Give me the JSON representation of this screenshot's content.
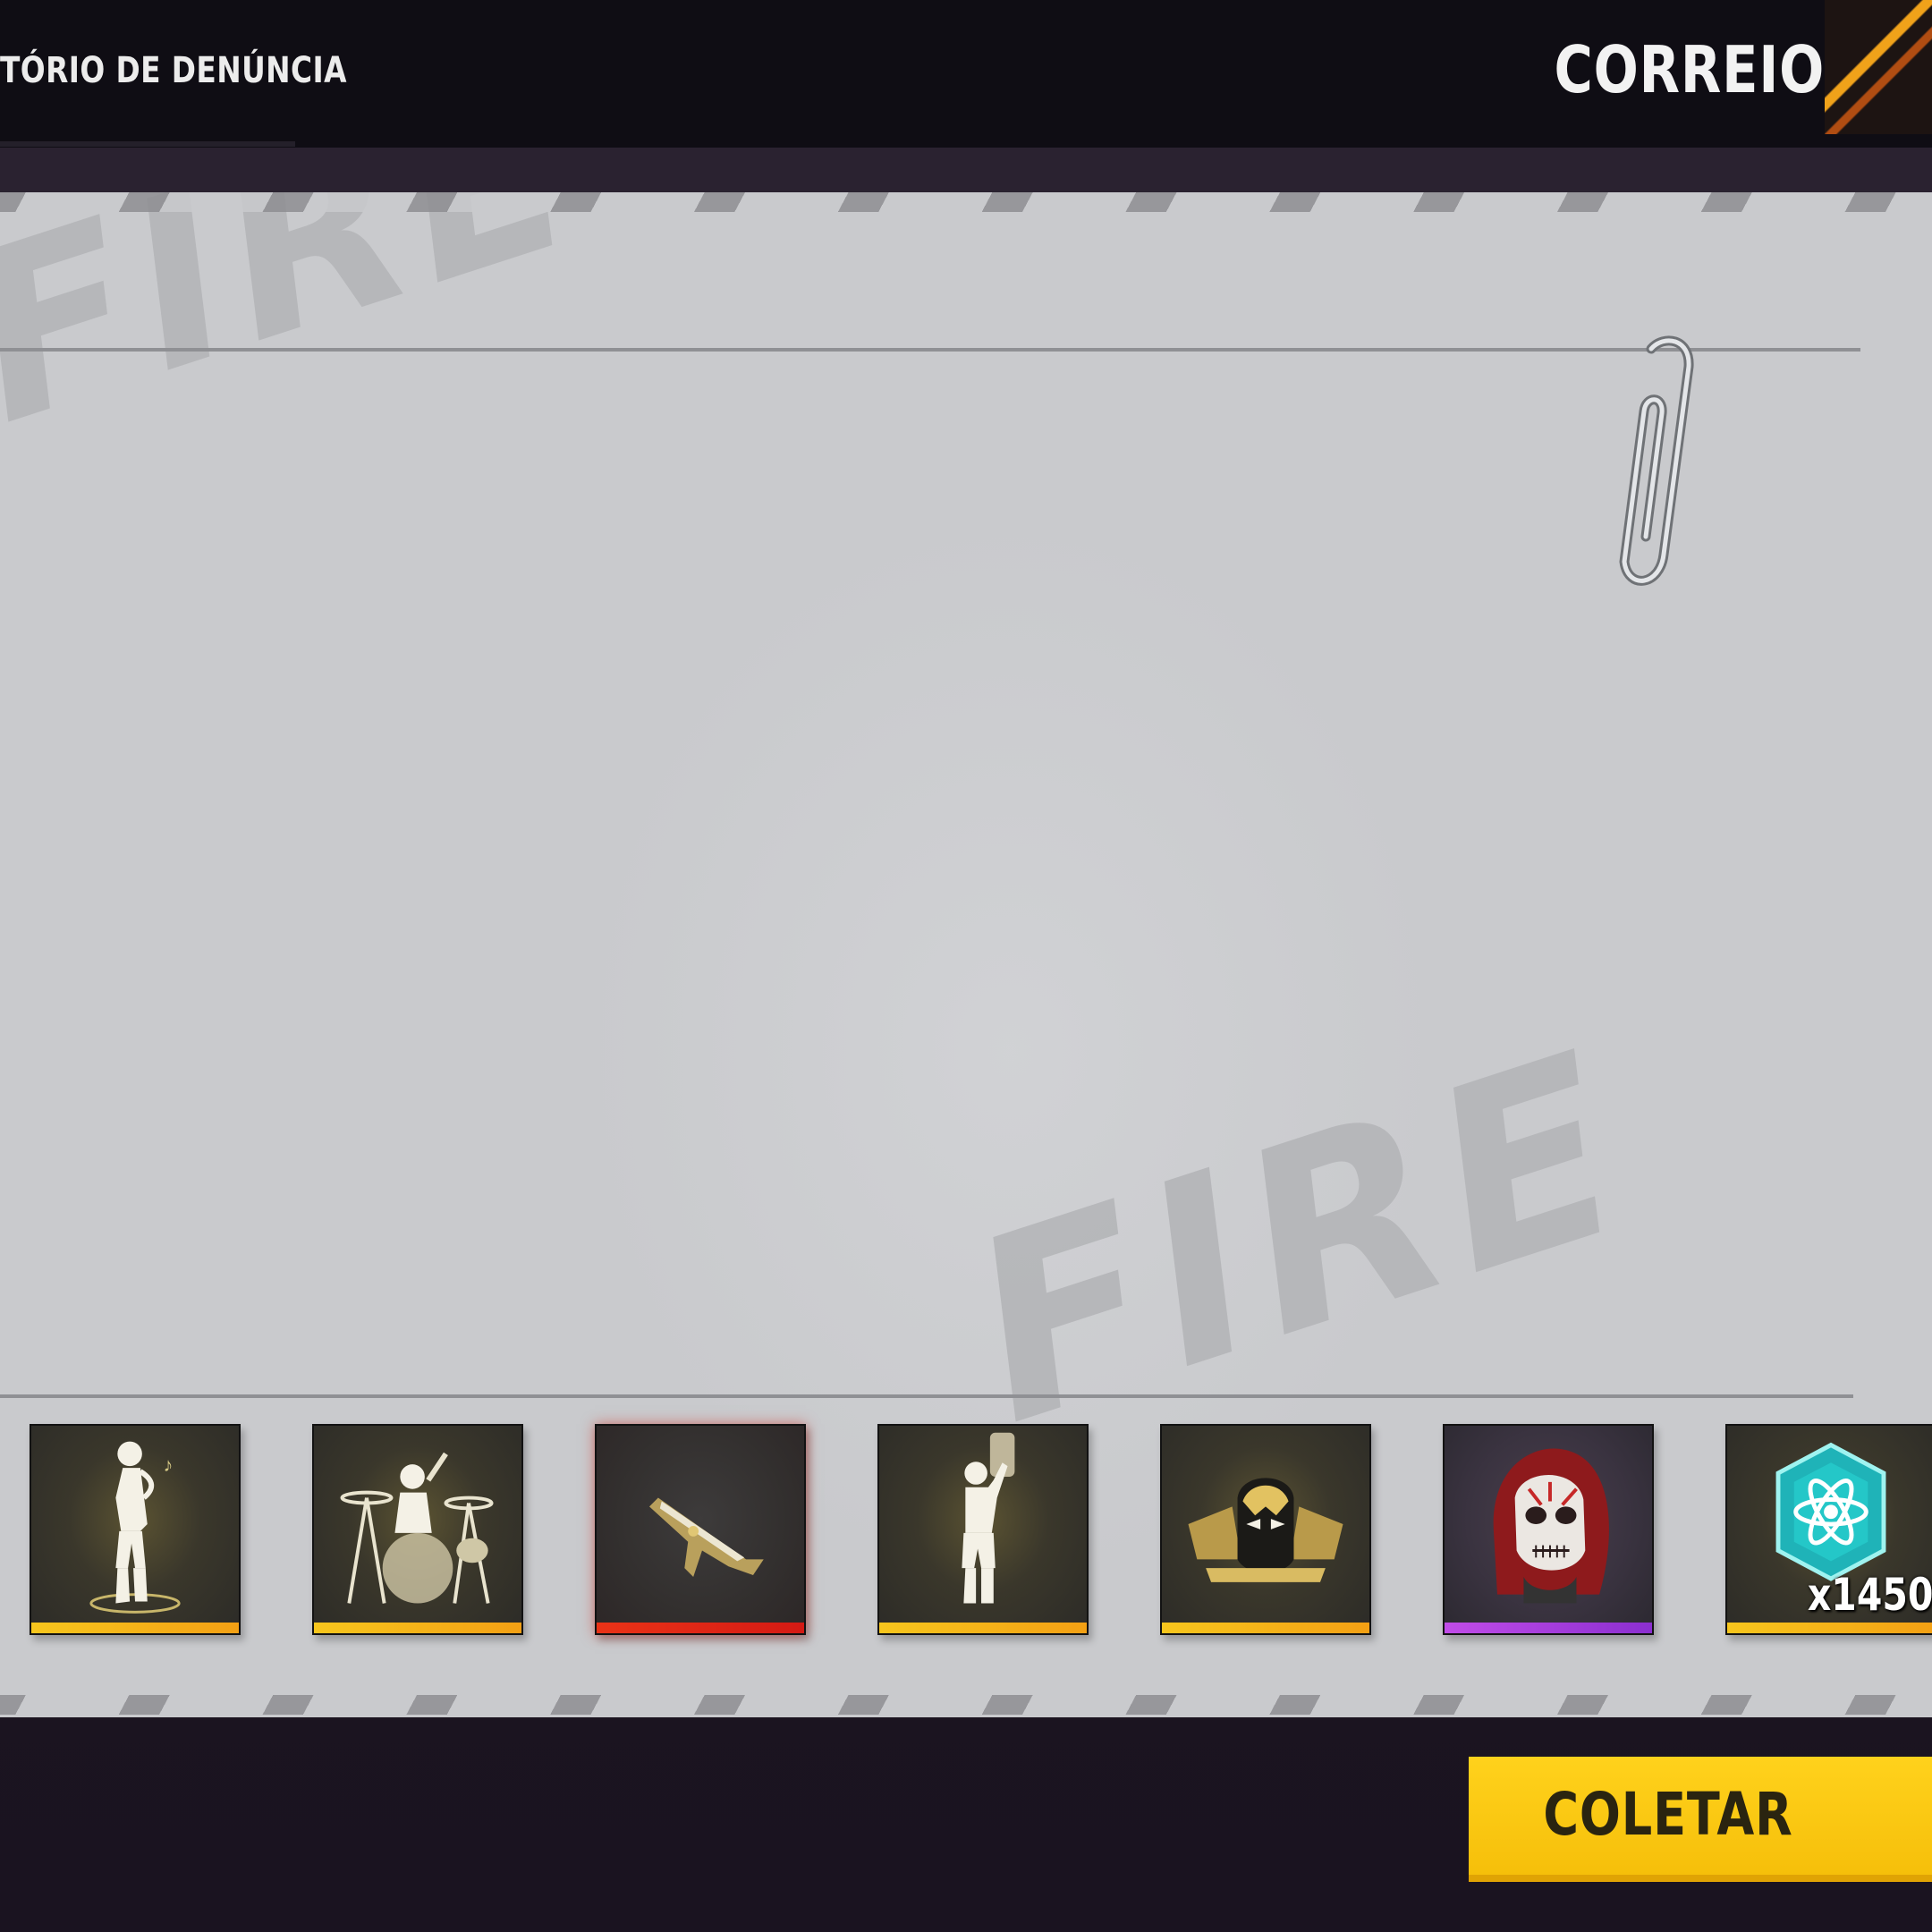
{
  "header": {
    "report_title": "TÓRIO DE DENÚNCIA",
    "mail_title": "CORREIO"
  },
  "watermark": {
    "top": "FIRE",
    "bottom": "FIRE"
  },
  "rewards": [
    {
      "name": "saxophone-emote",
      "icon": "saxophone-emote-icon",
      "rarity_color": "#f5b81a"
    },
    {
      "name": "drummer-emote",
      "icon": "drum-kit-emote-icon",
      "rarity_color": "#f5b81a"
    },
    {
      "name": "weapon-skin",
      "icon": "weapon-skin-icon",
      "rarity_color": "#e52a1a"
    },
    {
      "name": "trophy-emote",
      "icon": "trophy-emote-icon",
      "rarity_color": "#f5b81a"
    },
    {
      "name": "gold-mask-banner",
      "icon": "gold-mask-icon",
      "rarity_color": "#f5b81a"
    },
    {
      "name": "skull-mask",
      "icon": "skull-mask-icon",
      "rarity_color": "#b43ae6"
    },
    {
      "name": "diamond-gem",
      "icon": "diamond-gem-icon",
      "rarity_color": "#f5b81a",
      "quantity": "x1450"
    }
  ],
  "actions": {
    "collect_label": "COLETAR"
  },
  "colors": {
    "accent_yellow": "#f9c514",
    "card_background": "#c9cacd",
    "topbar": "#0f0d14"
  }
}
